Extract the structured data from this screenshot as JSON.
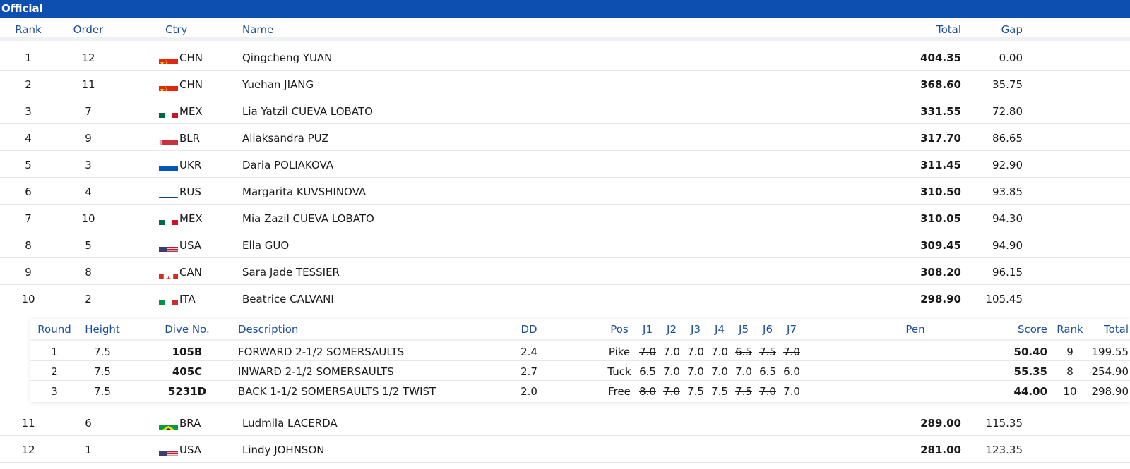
{
  "banner": {
    "title": "Official"
  },
  "columns": {
    "rank": "Rank",
    "order": "Order",
    "ctry": "Ctry",
    "name": "Name",
    "total": "Total",
    "gap": "Gap"
  },
  "athletes": [
    {
      "rank": "1",
      "order": "12",
      "ctry": "CHN",
      "flag": "china-flag-icon",
      "name": "Qingcheng YUAN",
      "total": "404.35",
      "gap": "0.00"
    },
    {
      "rank": "2",
      "order": "11",
      "ctry": "CHN",
      "flag": "china-flag-icon",
      "name": "Yuehan JIANG",
      "total": "368.60",
      "gap": "35.75"
    },
    {
      "rank": "3",
      "order": "7",
      "ctry": "MEX",
      "flag": "mexico-flag-icon",
      "name": "Lia Yatzil CUEVA LOBATO",
      "total": "331.55",
      "gap": "72.80"
    },
    {
      "rank": "4",
      "order": "9",
      "ctry": "BLR",
      "flag": "belarus-flag-icon",
      "name": "Aliaksandra PUZ",
      "total": "317.70",
      "gap": "86.65"
    },
    {
      "rank": "5",
      "order": "3",
      "ctry": "UKR",
      "flag": "ukraine-flag-icon",
      "name": "Daria POLIAKOVA",
      "total": "311.45",
      "gap": "92.90"
    },
    {
      "rank": "6",
      "order": "4",
      "ctry": "RUS",
      "flag": "russia-flag-icon",
      "name": "Margarita KUVSHINOVA",
      "total": "310.50",
      "gap": "93.85"
    },
    {
      "rank": "7",
      "order": "10",
      "ctry": "MEX",
      "flag": "mexico-flag-icon",
      "name": "Mia Zazil CUEVA LOBATO",
      "total": "310.05",
      "gap": "94.30"
    },
    {
      "rank": "8",
      "order": "5",
      "ctry": "USA",
      "flag": "usa-flag-icon",
      "name": "Ella GUO",
      "total": "309.45",
      "gap": "94.90"
    },
    {
      "rank": "9",
      "order": "8",
      "ctry": "CAN",
      "flag": "canada-flag-icon",
      "name": "Sara Jade TESSIER",
      "total": "308.20",
      "gap": "96.15"
    },
    {
      "rank": "10",
      "order": "2",
      "ctry": "ITA",
      "flag": "italy-flag-icon",
      "name": "Beatrice CALVANI",
      "total": "298.90",
      "gap": "105.45"
    },
    {
      "rank": "11",
      "order": "6",
      "ctry": "BRA",
      "flag": "brazil-flag-icon",
      "name": "Ludmila LACERDA",
      "total": "289.00",
      "gap": "115.35"
    },
    {
      "rank": "12",
      "order": "1",
      "ctry": "USA",
      "flag": "usa-flag-icon",
      "name": "Lindy JOHNSON",
      "total": "281.00",
      "gap": "123.35"
    }
  ],
  "dive_columns": {
    "round": "Round",
    "height": "Height",
    "dive_no": "Dive No.",
    "description": "Description",
    "dd": "DD",
    "pos": "Pos",
    "judges": [
      "J1",
      "J2",
      "J3",
      "J4",
      "J5",
      "J6",
      "J7"
    ],
    "pen": "Pen",
    "score": "Score",
    "rank": "Rank",
    "total": "Total"
  },
  "dives": [
    {
      "round": "1",
      "height": "7.5",
      "dive_no": "105B",
      "description": "FORWARD 2-1/2 SOMERSAULTS",
      "dd": "2.4",
      "pos": "Pike",
      "judges": [
        {
          "v": "7.0",
          "x": true
        },
        {
          "v": "7.0",
          "x": false
        },
        {
          "v": "7.0",
          "x": false
        },
        {
          "v": "7.0",
          "x": false
        },
        {
          "v": "6.5",
          "x": true
        },
        {
          "v": "7.5",
          "x": true
        },
        {
          "v": "7.0",
          "x": true
        }
      ],
      "pen": "",
      "score": "50.40",
      "rank": "9",
      "total": "199.55"
    },
    {
      "round": "2",
      "height": "7.5",
      "dive_no": "405C",
      "description": "INWARD 2-1/2 SOMERSAULTS",
      "dd": "2.7",
      "pos": "Tuck",
      "judges": [
        {
          "v": "6.5",
          "x": true
        },
        {
          "v": "7.0",
          "x": false
        },
        {
          "v": "7.0",
          "x": false
        },
        {
          "v": "7.0",
          "x": true
        },
        {
          "v": "7.0",
          "x": true
        },
        {
          "v": "6.5",
          "x": false
        },
        {
          "v": "6.0",
          "x": true
        }
      ],
      "pen": "",
      "score": "55.35",
      "rank": "8",
      "total": "254.90"
    },
    {
      "round": "3",
      "height": "7.5",
      "dive_no": "5231D",
      "description": "BACK 1-1/2 SOMERSAULTS 1/2 TWIST",
      "dd": "2.0",
      "pos": "Free",
      "judges": [
        {
          "v": "8.0",
          "x": true
        },
        {
          "v": "7.0",
          "x": true
        },
        {
          "v": "7.5",
          "x": false
        },
        {
          "v": "7.5",
          "x": false
        },
        {
          "v": "7.5",
          "x": true
        },
        {
          "v": "7.0",
          "x": true
        },
        {
          "v": "7.0",
          "x": false
        }
      ],
      "pen": "",
      "score": "44.00",
      "rank": "10",
      "total": "298.90"
    }
  ],
  "colors": {
    "banner": "#0d4fb1",
    "header_text": "#1d4f99"
  }
}
